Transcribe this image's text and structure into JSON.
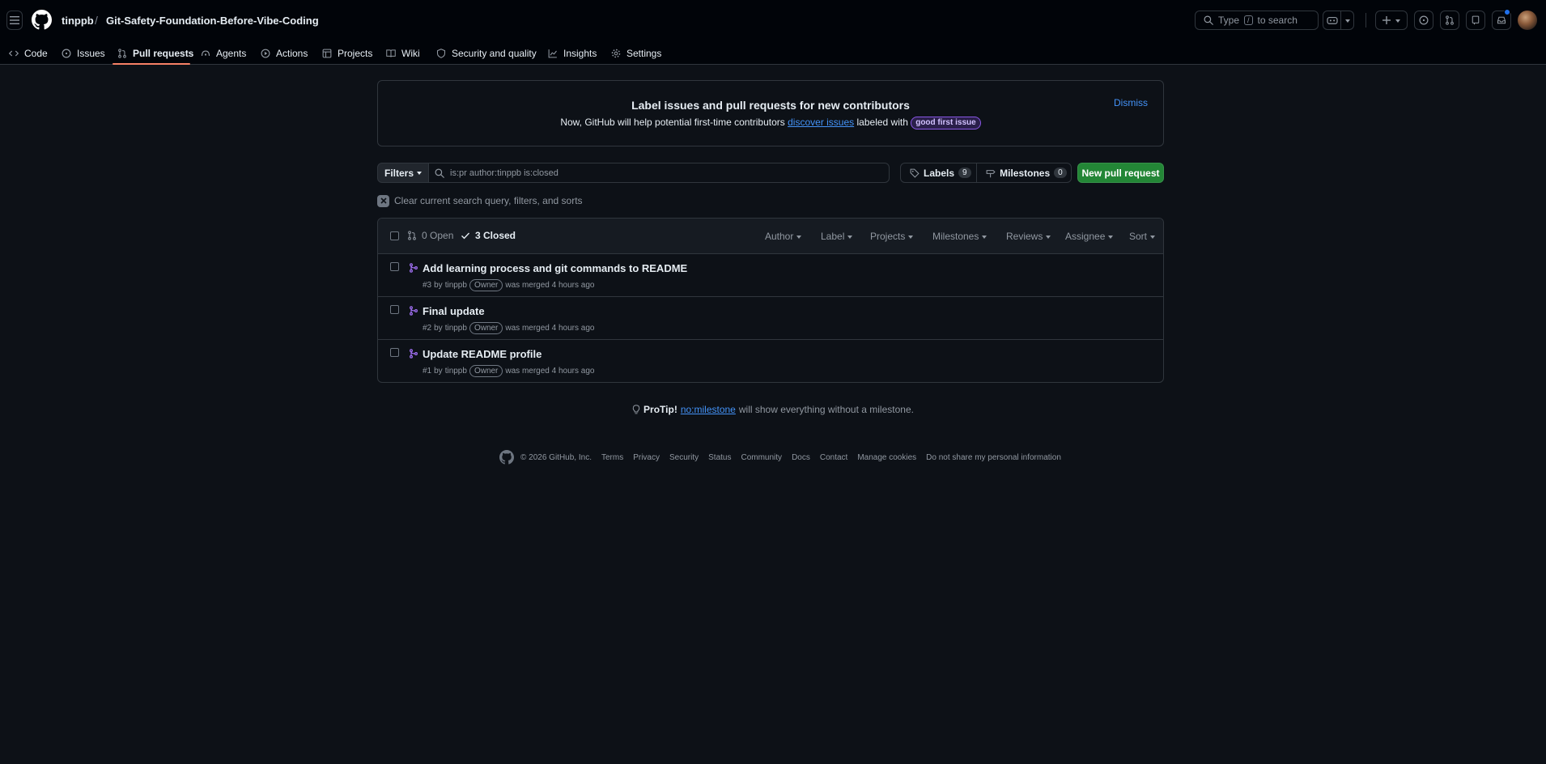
{
  "header": {
    "owner": "tinppb",
    "separator": "/",
    "repo": "Git-Safety-Foundation-Before-Vibe-Coding",
    "search_prefix": "Type",
    "search_key": "/",
    "search_suffix": "to search"
  },
  "nav": [
    {
      "label": "Code",
      "icon": "code-icon"
    },
    {
      "label": "Issues",
      "icon": "issue-opened-icon"
    },
    {
      "label": "Pull requests",
      "icon": "git-pull-request-icon",
      "active": true
    },
    {
      "label": "Agents",
      "icon": "agent-icon"
    },
    {
      "label": "Actions",
      "icon": "play-icon"
    },
    {
      "label": "Projects",
      "icon": "table-icon"
    },
    {
      "label": "Wiki",
      "icon": "book-icon"
    },
    {
      "label": "Security and quality",
      "icon": "shield-icon"
    },
    {
      "label": "Insights",
      "icon": "graph-icon"
    },
    {
      "label": "Settings",
      "icon": "gear-icon"
    }
  ],
  "banner": {
    "title": "Label issues and pull requests for new contributors",
    "text_before": "Now, GitHub will help potential first-time contributors",
    "link": "discover issues",
    "text_after": "labeled with",
    "label": "good first issue",
    "dismiss": "Dismiss"
  },
  "toolbar": {
    "filters": "Filters",
    "query": "is:pr author:tinppb is:closed",
    "labels": "Labels",
    "labels_count": "9",
    "milestones": "Milestones",
    "milestones_count": "0",
    "new_pr": "New pull request",
    "clear": "Clear current search query, filters, and sorts"
  },
  "list": {
    "open": "0 Open",
    "closed": "3 Closed",
    "filters": [
      "Author",
      "Label",
      "Projects",
      "Milestones",
      "Reviews",
      "Assignee",
      "Sort"
    ],
    "items": [
      {
        "title": "Add learning process and git commands to README",
        "number": "#3",
        "by": "by",
        "author": "tinppb",
        "badge": "Owner",
        "status": "was merged 4 hours ago"
      },
      {
        "title": "Final update",
        "number": "#2",
        "by": "by",
        "author": "tinppb",
        "badge": "Owner",
        "status": "was merged 4 hours ago"
      },
      {
        "title": "Update README profile",
        "number": "#1",
        "by": "by",
        "author": "tinppb",
        "badge": "Owner",
        "status": "was merged 4 hours ago"
      }
    ]
  },
  "protip": {
    "label": "ProTip!",
    "link": "no:milestone",
    "text": "will show everything without a milestone."
  },
  "footer": {
    "copyright": "© 2026 GitHub, Inc.",
    "links": [
      "Terms",
      "Privacy",
      "Security",
      "Status",
      "Community",
      "Docs",
      "Contact",
      "Manage cookies",
      "Do not share my personal information"
    ]
  },
  "colors": {
    "merged": "#a371f7",
    "accent_link": "#4493f8",
    "primary_button": "#238636",
    "active_tab_underline": "#f78166"
  }
}
